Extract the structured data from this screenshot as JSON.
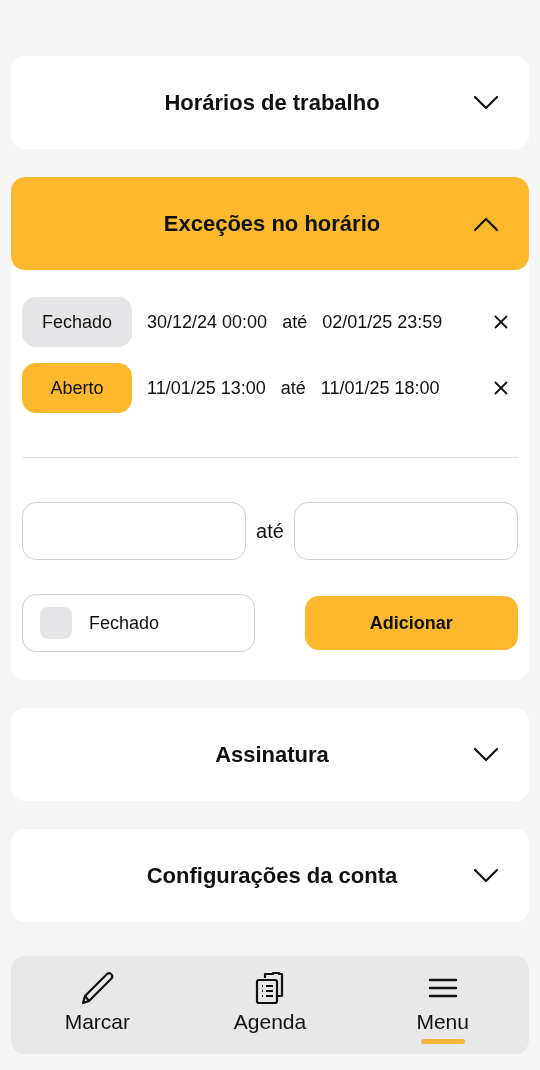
{
  "sections": [
    {
      "title": "Horários de trabalho",
      "expanded": false
    },
    {
      "title": "Exceções no horário",
      "expanded": true,
      "exceptions": [
        {
          "kind": "closed",
          "status": "Fechado",
          "start": "30/12/24 00:00",
          "separator": "até",
          "end": "02/01/25 23:59"
        },
        {
          "kind": "open",
          "status": "Aberto",
          "start": "11/01/25 13:00",
          "separator": "até",
          "end": "11/01/25 18:00"
        }
      ],
      "form": {
        "separator": "até",
        "closed_checkbox": {
          "label": "Fechado",
          "checked": false
        },
        "add_button": "Adicionar"
      }
    },
    {
      "title": "Assinatura",
      "expanded": false
    },
    {
      "title": "Configurações da conta",
      "expanded": false
    }
  ],
  "bottom_nav": [
    {
      "label": "Marcar",
      "kind": "pencil",
      "selected": false
    },
    {
      "label": "Agenda",
      "kind": "clipboard",
      "selected": false
    },
    {
      "label": "Menu",
      "kind": "menu",
      "selected": true
    }
  ]
}
